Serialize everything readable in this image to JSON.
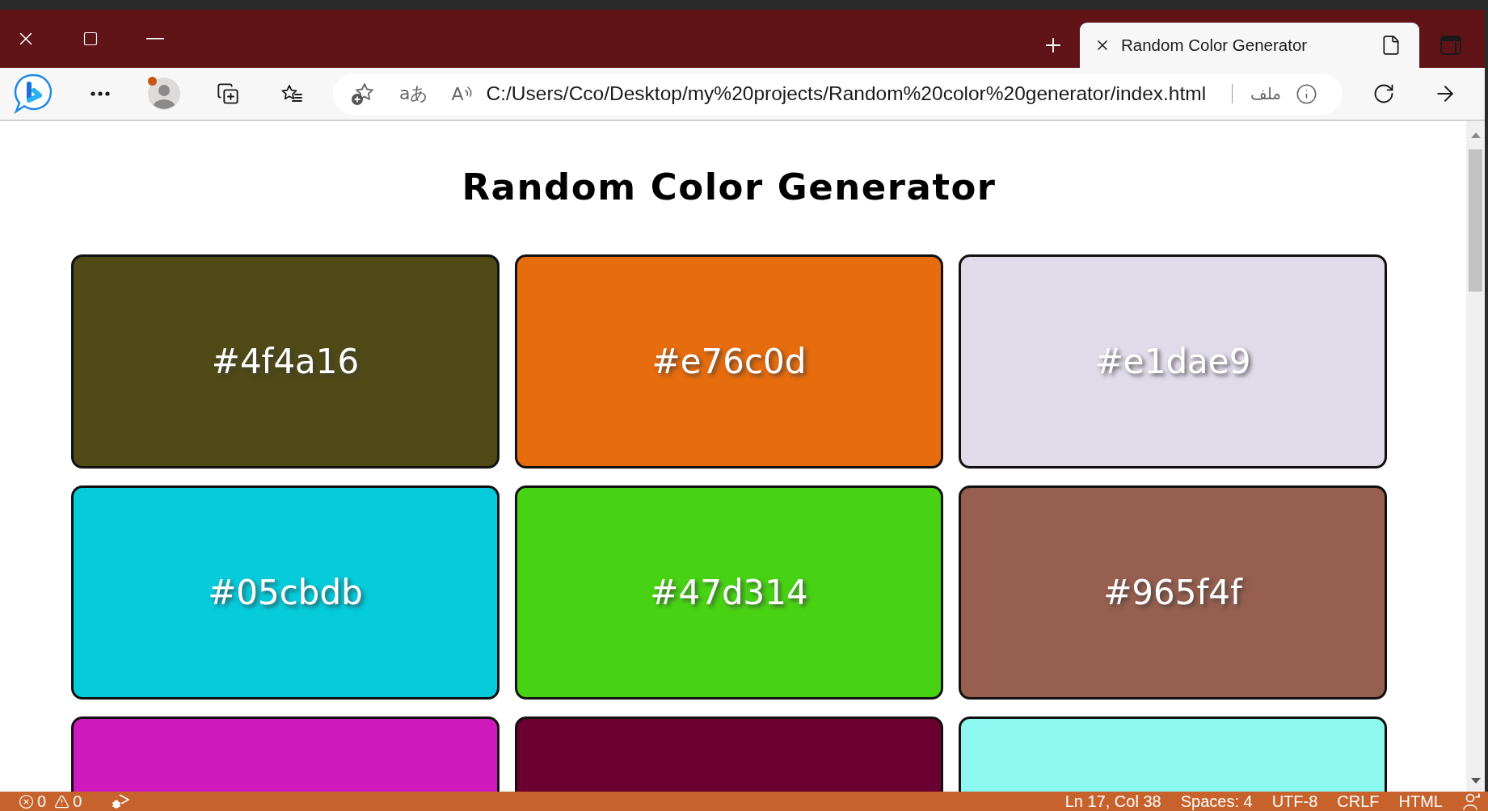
{
  "browser": {
    "tab": {
      "title": "Random Color Generator"
    },
    "address_bar": {
      "translate_label": "aあ",
      "read_aloud_label": "A",
      "url": "C:/Users/Cco/Desktop/my%20projects/Random%20color%20generator/index.html",
      "site_info": "ملف"
    }
  },
  "page": {
    "heading": "Random Color Generator",
    "cards": [
      {
        "color": "#4f4a16",
        "label": "#4f4a16"
      },
      {
        "color": "#e76c0d",
        "label": "#e76c0d"
      },
      {
        "color": "#e1dae9",
        "label": "#e1dae9"
      },
      {
        "color": "#05cbdb",
        "label": "#05cbdb"
      },
      {
        "color": "#47d314",
        "label": "#47d314"
      },
      {
        "color": "#965f4f",
        "label": "#965f4f"
      },
      {
        "color": "#cf1bbd"
      },
      {
        "color": "#6b0030"
      },
      {
        "color": "#8cf8f0"
      }
    ]
  },
  "status_bar": {
    "errors": "0",
    "warnings": "0",
    "items": [
      "Ln 17, Col 38",
      "Spaces: 4",
      "UTF-8",
      "CRLF",
      "HTML"
    ]
  }
}
